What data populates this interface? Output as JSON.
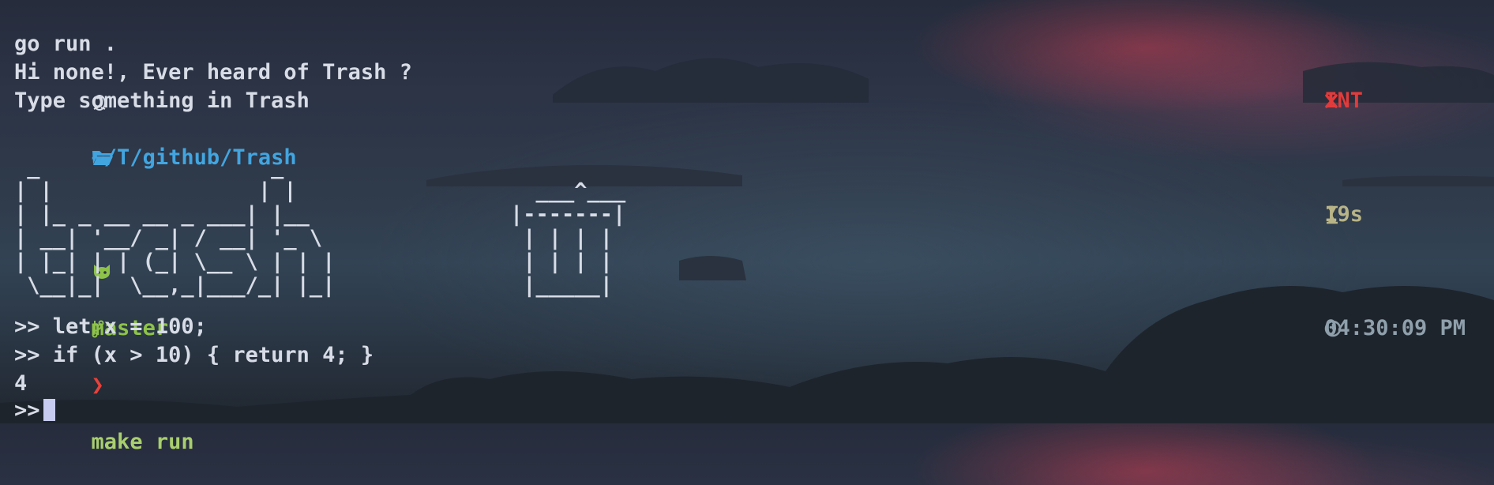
{
  "prompt": {
    "os_icon": "linux-tux-icon",
    "folder_icon": "folder-open-icon",
    "path": "~/T/github/Trash",
    "github_icon": "github-octocat-icon",
    "branch_icon": "git-branch-icon",
    "branch": "master",
    "prompt_char": "❯",
    "command": "make run",
    "exit_icon": "cross-icon",
    "exit_status": "INT",
    "duration_icon": "hourglass-icon",
    "duration": "19s",
    "clock_icon": "clock-icon",
    "time": "04:30:09 PM"
  },
  "output": {
    "line1": "go run .",
    "line2": "Hi none!, Ever heard of Trash ?",
    "line3": "Type something in Trash"
  },
  "ascii_logo": " _                  _\n| |                | |\n| |_ _ __ __ _ ___| |__\n| __| '__/ _| / __| '_ \\\n| |_| | | (_| \\__ \\ | | |\n \\__|_|  \\__,_|___/_| |_|",
  "ascii_bin": "  ___^___\n|-------|\n | | | |\n | | | |\n |_____|",
  "repl": {
    "prefix": ">>",
    "line1": " let x = 100;",
    "line2": " if (x > 10) { return 4; }",
    "result": "4"
  },
  "colors": {
    "path": "#42a5e0",
    "git": "#8ec34a",
    "error": "#e23b3b",
    "text": "#d7dce6"
  }
}
